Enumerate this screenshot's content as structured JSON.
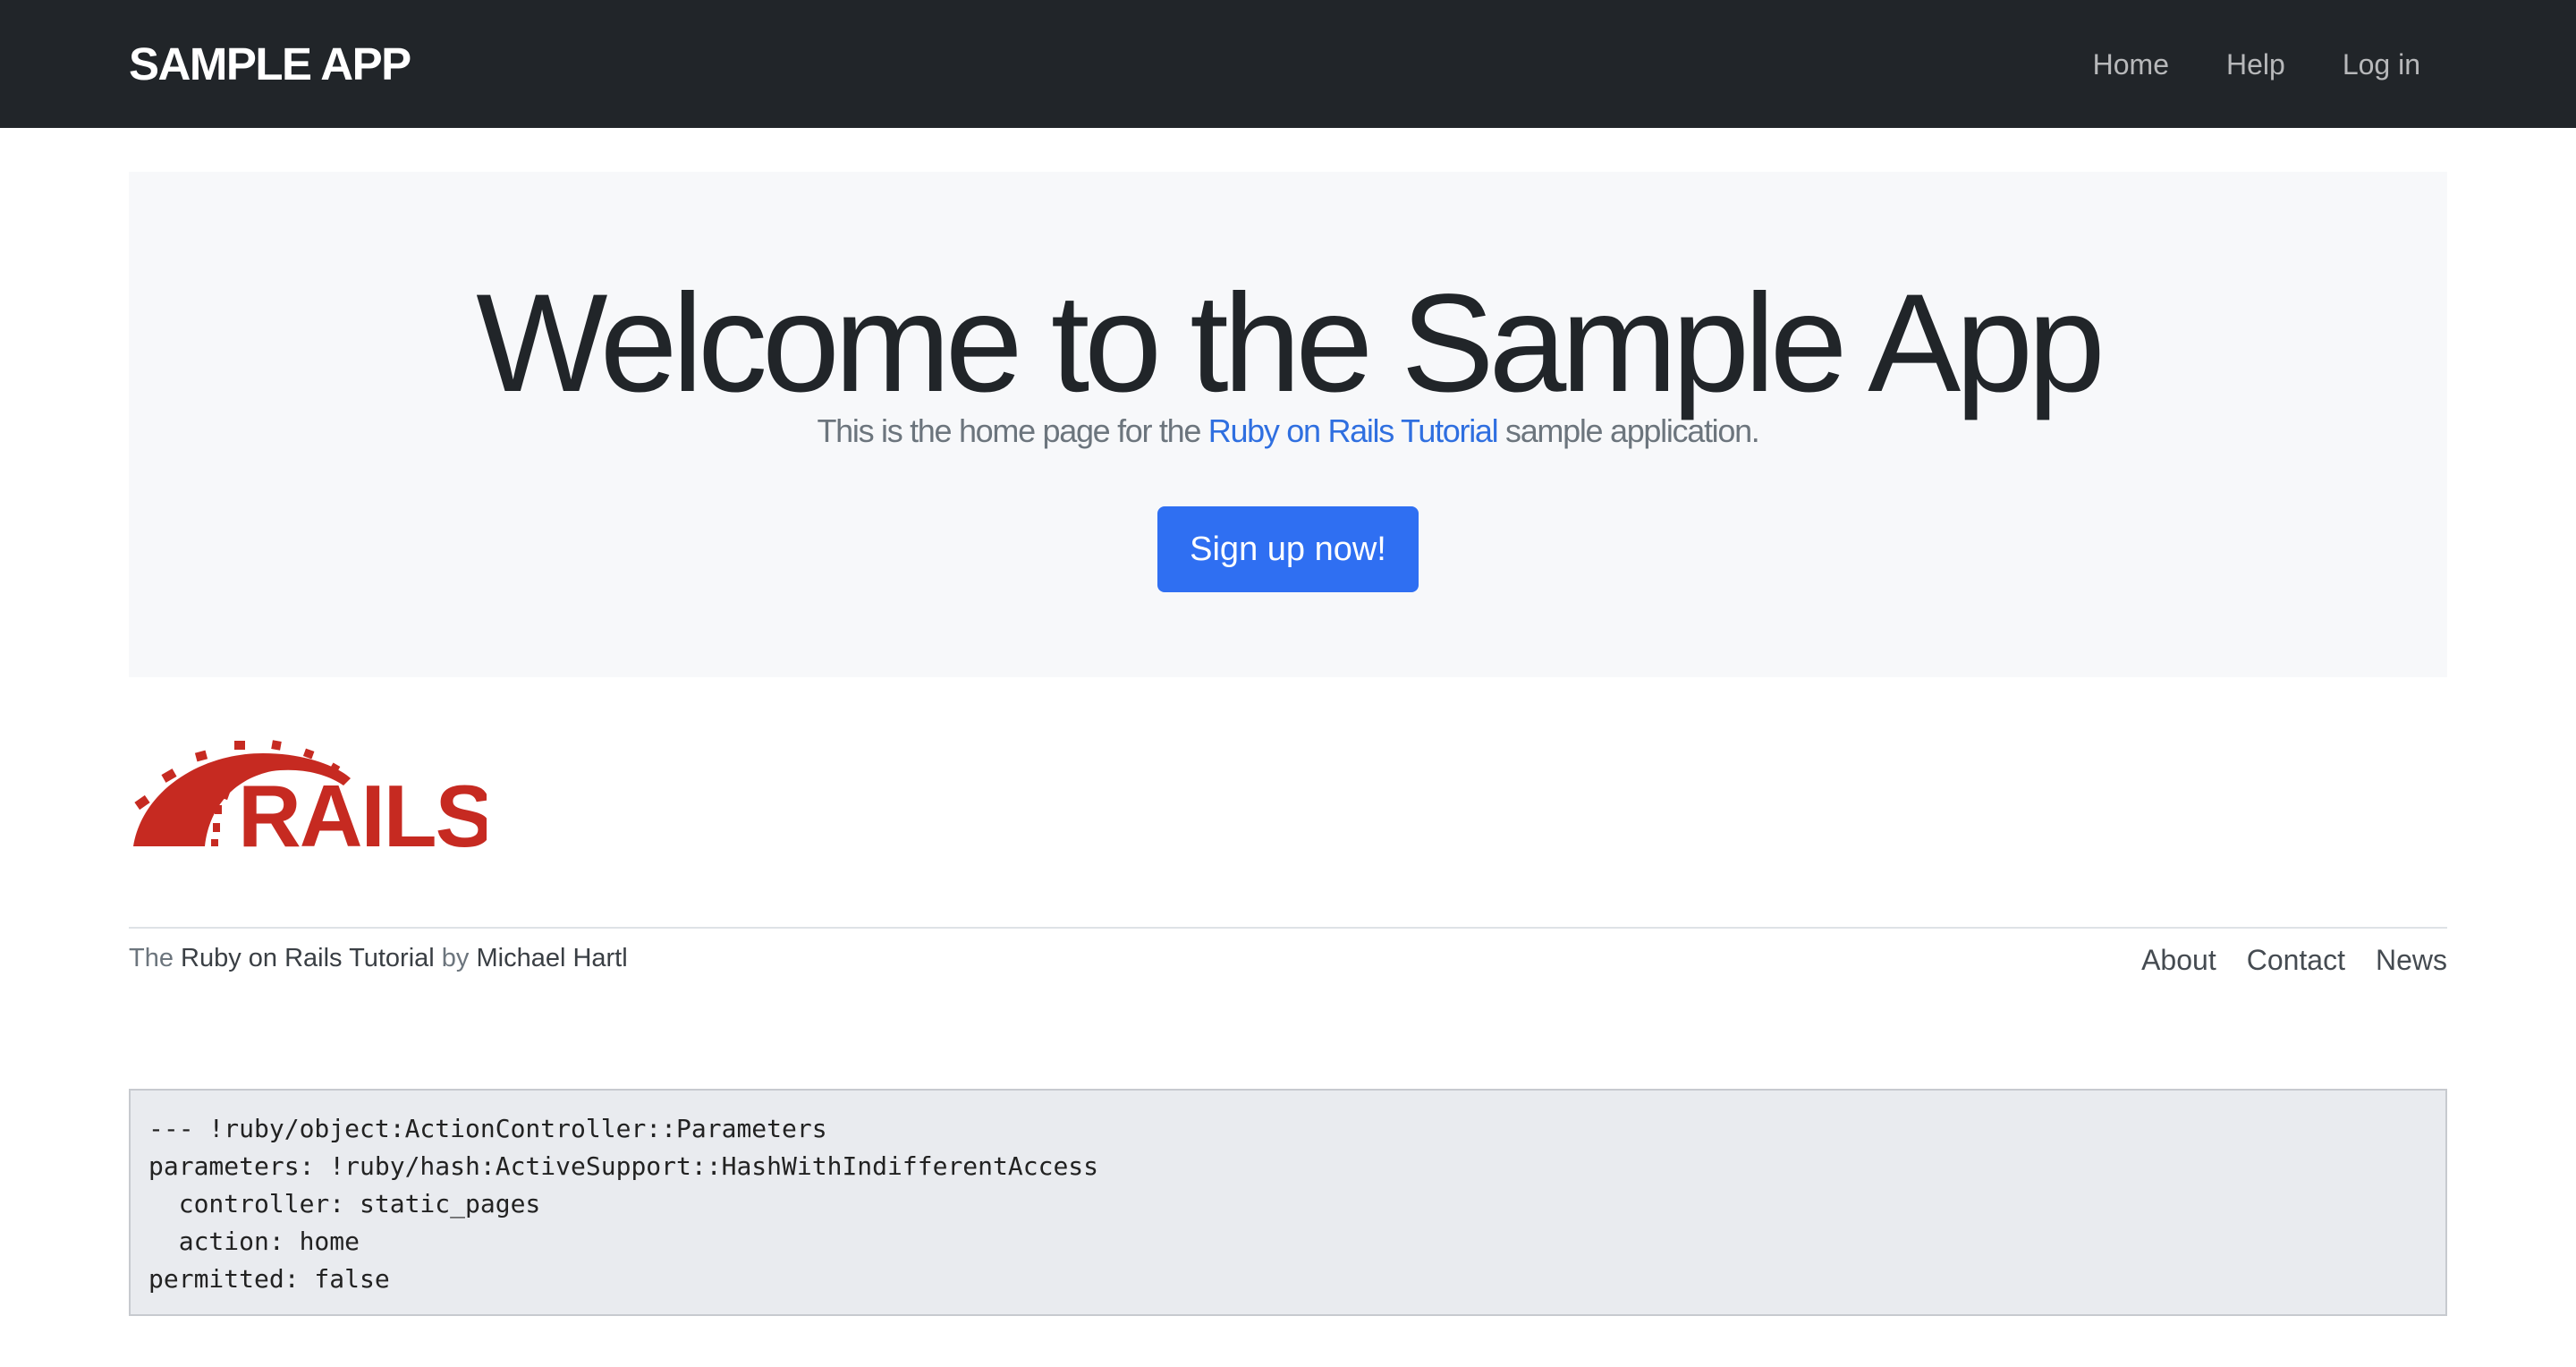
{
  "header": {
    "brand": "SAMPLE APP",
    "nav": [
      {
        "label": "Home"
      },
      {
        "label": "Help"
      },
      {
        "label": "Log in"
      }
    ]
  },
  "hero": {
    "title": "Welcome to the Sample App",
    "subtitle_pre": "This is the home page for the ",
    "subtitle_link": "Ruby on Rails Tutorial",
    "subtitle_post": " sample application.",
    "signup_label": "Sign up now!"
  },
  "logo": {
    "text": "RAILS",
    "icon": "rails-logo-icon",
    "color": "#c62a21"
  },
  "footer": {
    "credit_pre": "The ",
    "credit_link": "Ruby on Rails Tutorial",
    "credit_mid": " by ",
    "credit_author": "Michael Hartl",
    "links": [
      {
        "label": "About"
      },
      {
        "label": "Contact"
      },
      {
        "label": "News"
      }
    ]
  },
  "debug": {
    "lines": [
      "--- !ruby/object:ActionController::Parameters",
      "parameters: !ruby/hash:ActiveSupport::HashWithIndifferentAccess",
      "  controller: static_pages",
      "  action: home",
      "permitted: false"
    ]
  },
  "colors": {
    "navbar": "#212529",
    "primary": "#2f6ff2",
    "link": "#2f6fe0",
    "rails_red": "#c62a21"
  }
}
